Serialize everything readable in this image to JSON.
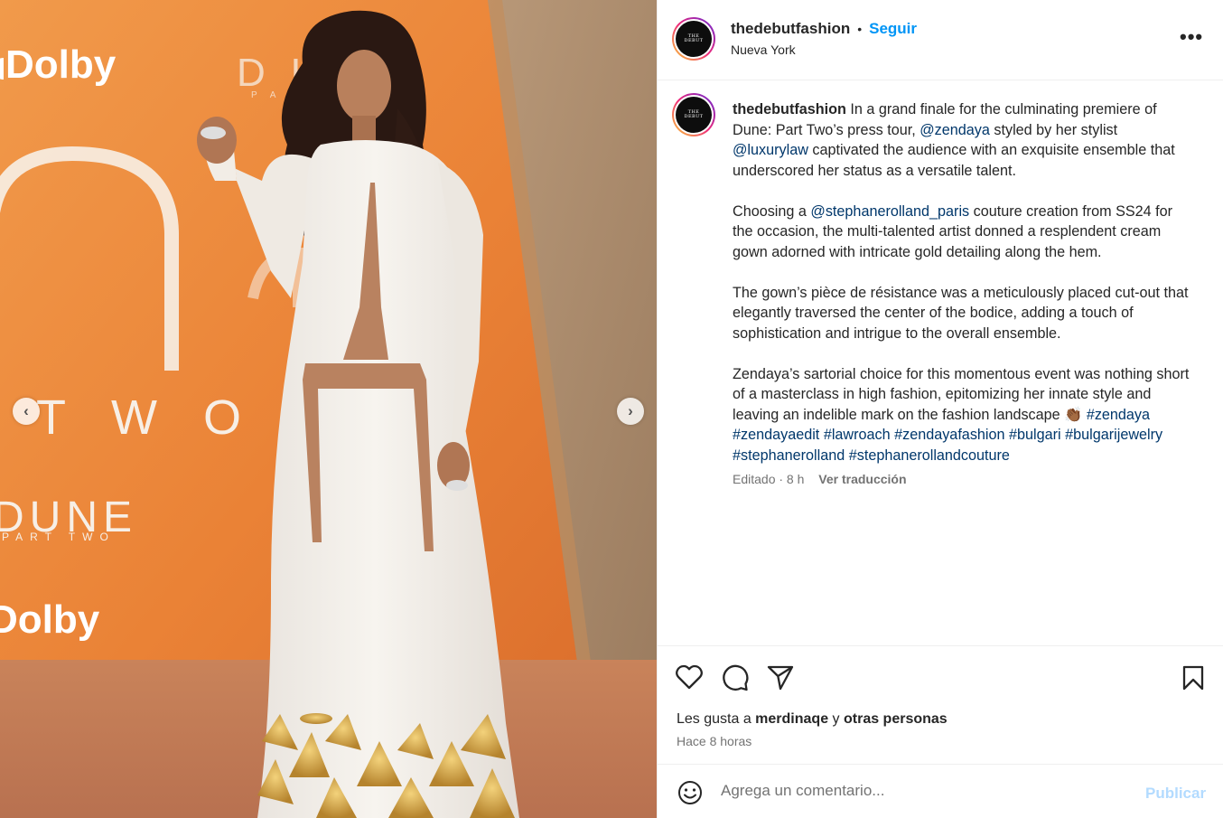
{
  "post": {
    "username": "thedebutfashion",
    "follow_label": "Seguir",
    "separator": "•",
    "location": "Nueva York",
    "more_label": "•••",
    "avatar_text_line1": "THE",
    "avatar_text_line2": "DEBUT"
  },
  "media": {
    "backdrop_texts": {
      "dolby_top": "Dolby",
      "dolby_bottom": "Dolby",
      "two": "T W O",
      "dune": "DUNE",
      "part_two": "PART TWO",
      "partial_dune": "D U",
      "partial_pa": "P A"
    },
    "prev_label": "‹",
    "next_label": "›"
  },
  "caption": {
    "username": "thedebutfashion",
    "p1_a": " In a grand finale for the culminating premiere of Dune: Part Two’s press tour, ",
    "mention1": "@zendaya",
    "p1_b": " styled by her stylist ",
    "mention2": "@luxurylaw",
    "p1_c": " captivated the audience with an exquisite ensemble that underscored her status as a versatile talent.",
    "p2_a": "Choosing a ",
    "mention3": "@stephanerolland_paris",
    "p2_b": " couture creation from SS24 for the occasion, the multi-talented artist donned a resplendent cream gown adorned with intricate gold detailing along the hem.",
    "p3": "The gown’s pièce de résistance was a meticulously placed cut-out that elegantly traversed the center of the bodice, adding a touch of sophistication and intrigue to the overall ensemble.",
    "p4": "Zendaya’s sartorial choice for this momentous event was nothing short of a masterclass in high fashion, epitomizing her innate style and leaving an indelible mark on the fashion landscape 👏🏾",
    "hashtags": [
      "#zendaya",
      "#zendayaedit",
      "#lawroach",
      "#zendayafashion",
      "#bulgari",
      "#bulgarijewelry",
      "#stephanerolland",
      "#stephanerollandcouture"
    ],
    "edited_time": "Editado · 8 h",
    "translate_label": "Ver traducción"
  },
  "actions": {
    "likes_prefix": "Les gusta a ",
    "liker": "merdinaqe",
    "likes_mid": " y ",
    "likes_others": "otras personas",
    "time": "Hace 8 horas"
  },
  "comment": {
    "placeholder": "Agrega un comentario...",
    "publish_label": "Publicar"
  },
  "colors": {
    "follow_blue": "#0095f6",
    "mention_blue": "#00376b",
    "publish_disabled": "#b3dbff",
    "secondary_text": "#737373"
  }
}
